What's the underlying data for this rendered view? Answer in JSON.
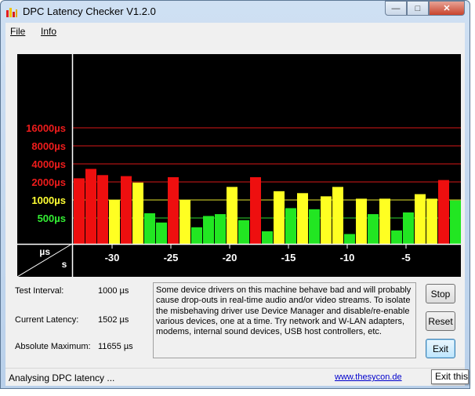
{
  "window": {
    "title": "DPC Latency Checker V1.2.0"
  },
  "menu": {
    "file": "File",
    "info": "Info"
  },
  "chart_data": {
    "type": "bar",
    "y_scale": "log2",
    "y_tick_labels": [
      "16000µs",
      "8000µs",
      "4000µs",
      "2000µs",
      "1000µs",
      "500µs"
    ],
    "y_tick_values": [
      16000,
      8000,
      4000,
      2000,
      1000,
      500
    ],
    "y_tick_colors": [
      "#ee1c1c",
      "#ee1c1c",
      "#ee1c1c",
      "#ee1c1c",
      "#ffff33",
      "#33ee33"
    ],
    "x_tick_labels": [
      "-30",
      "-25",
      "-20",
      "-15",
      "-10",
      "-5"
    ],
    "x_tick_values": [
      -30,
      -25,
      -20,
      -15,
      -10,
      -5
    ],
    "x_corner_top": "µs",
    "x_corner_bottom": "s",
    "grid": true,
    "thresholds": {
      "green_below": 1000,
      "red_from": 2000
    },
    "colors": {
      "green": "#22e622",
      "yellow": "#ffff22",
      "red": "#ee0f0f"
    },
    "x": [
      -33,
      -32,
      -31,
      -30,
      -29,
      -28,
      -27,
      -26,
      -25,
      -24,
      -23,
      -22,
      -21,
      -20,
      -19,
      -18,
      -17,
      -16,
      -15,
      -14,
      -13,
      -12,
      -11,
      -10,
      -9,
      -8,
      -7,
      -6,
      -5,
      -4,
      -3,
      -2,
      -1
    ],
    "values": [
      2300,
      3300,
      2600,
      1000,
      2500,
      1950,
      600,
      420,
      2400,
      1000,
      350,
      540,
      580,
      1650,
      460,
      2400,
      300,
      1400,
      730,
      1300,
      700,
      1150,
      1650,
      270,
      1050,
      580,
      1050,
      310,
      620,
      1250,
      1050,
      2150,
      980
    ]
  },
  "info": {
    "test_interval_label": "Test Interval:",
    "test_interval_value": "1000 µs",
    "current_latency_label": "Current Latency:",
    "current_latency_value": "1502 µs",
    "absolute_max_label": "Absolute Maximum:",
    "absolute_max_value": "11655 µs"
  },
  "message": "Some device drivers on this machine behave bad and will probably cause drop-outs in real-time audio and/or video streams. To isolate the misbehaving driver use Device Manager and disable/re-enable various devices, one at a time. Try network and W-LAN adapters, modems, internal sound devices, USB host controllers, etc.",
  "buttons": {
    "stop": "Stop",
    "reset": "Reset",
    "exit": "Exit"
  },
  "status": {
    "text": "Analysing DPC latency ...",
    "link": "www.thesycon.de"
  },
  "tooltip": "Exit this"
}
